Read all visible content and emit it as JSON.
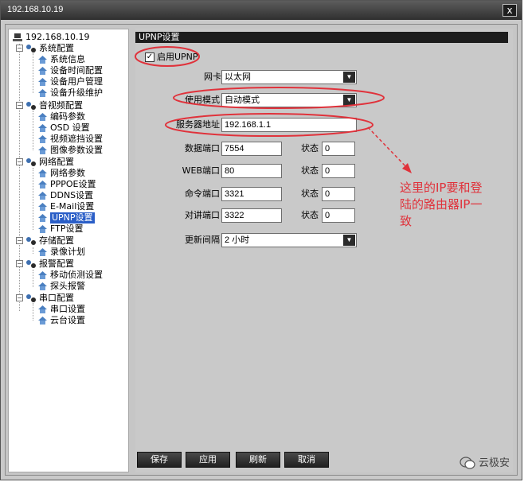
{
  "window": {
    "title": "192.168.10.19",
    "close_label": "x"
  },
  "sidebar": {
    "root": "192.168.10.19",
    "groups": [
      {
        "label": "系统配置",
        "items": [
          "系统信息",
          "设备时间配置",
          "设备用户管理",
          "设备升级维护"
        ]
      },
      {
        "label": "音视频配置",
        "items": [
          "编码参数",
          "OSD 设置",
          "视频遮挡设置",
          "图像参数设置"
        ]
      },
      {
        "label": "网络配置",
        "items": [
          "网络参数",
          "PPPOE设置",
          "DDNS设置",
          "E-Mail设置",
          "UPNP设置",
          "FTP设置"
        ]
      },
      {
        "label": "存储配置",
        "items": [
          "录像计划"
        ]
      },
      {
        "label": "报警配置",
        "items": [
          "移动侦测设置",
          "探头报警"
        ]
      },
      {
        "label": "串口配置",
        "items": [
          "串口设置",
          "云台设置"
        ]
      }
    ],
    "selected": "UPNP设置"
  },
  "panel": {
    "header": "UPNP设置",
    "enable_upnp": {
      "label": "启用UPNP",
      "checked": true,
      "mark": "✓"
    },
    "nic": {
      "label": "网卡",
      "value": "以太网"
    },
    "mode": {
      "label": "使用模式",
      "value": "自动模式"
    },
    "server": {
      "label": "服务器地址",
      "value": "192.168.1.1"
    },
    "ports": [
      {
        "label": "数据端口",
        "value": "7554",
        "status_label": "状态",
        "status": "0"
      },
      {
        "label": "WEB端口",
        "value": "80",
        "status_label": "状态",
        "status": "0"
      },
      {
        "label": "命令端口",
        "value": "3321",
        "status_label": "状态",
        "status": "0"
      },
      {
        "label": "对讲端口",
        "value": "3322",
        "status_label": "状态",
        "status": "0"
      }
    ],
    "interval": {
      "label": "更新间隔",
      "value": "2 小时"
    }
  },
  "buttons": {
    "save": "保存",
    "apply": "应用",
    "refresh": "刷新",
    "cancel": "取消"
  },
  "annotation": {
    "line1": "这里的IP要和登",
    "line2": "陆的路由器IP一",
    "line3": "致",
    "color": "#e0323b"
  },
  "watermark": "云极安"
}
